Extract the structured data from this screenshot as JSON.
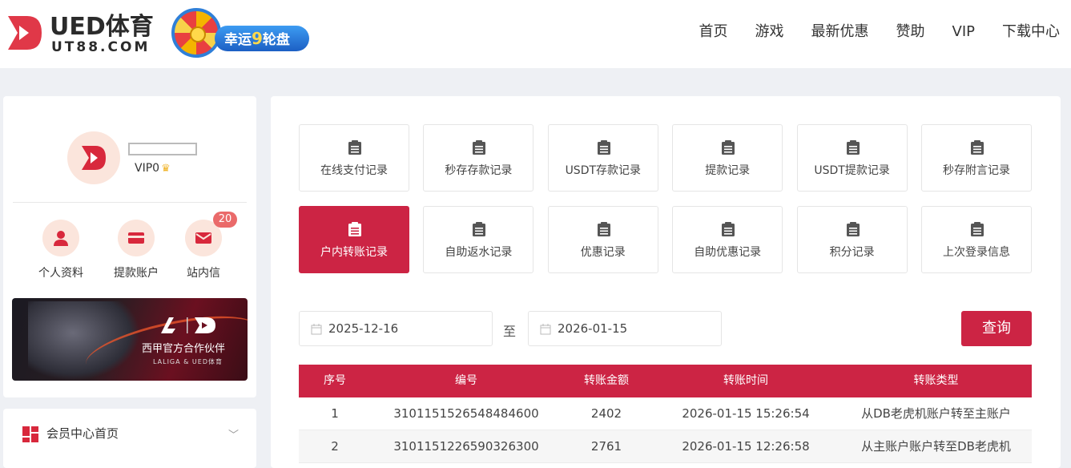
{
  "brand": {
    "name": "UED体育",
    "domain": "UT88.COM",
    "promo_label": "幸运",
    "promo_number": "9",
    "promo_suffix": "轮盘"
  },
  "nav": [
    "首页",
    "游戏",
    "最新优惠",
    "赞助",
    "VIP",
    "下载中心"
  ],
  "profile": {
    "vip_level": "VIP0",
    "quick_links": [
      {
        "label": "个人资料",
        "icon": "user-icon"
      },
      {
        "label": "提款账户",
        "icon": "card-icon"
      },
      {
        "label": "站内信",
        "icon": "mail-icon"
      }
    ],
    "message_count": "20",
    "banner_text": "西甲官方合作伙伴",
    "banner_sub": "LALIGA & UED体育"
  },
  "menu": {
    "label": "会员中心首页"
  },
  "tiles": [
    {
      "label": "在线支付记录",
      "active": false
    },
    {
      "label": "秒存存款记录",
      "active": false
    },
    {
      "label": "USDT存款记录",
      "active": false
    },
    {
      "label": "提款记录",
      "active": false
    },
    {
      "label": "USDT提款记录",
      "active": false
    },
    {
      "label": "秒存附言记录",
      "active": false
    },
    {
      "label": "户内转账记录",
      "active": true
    },
    {
      "label": "自助返水记录",
      "active": false
    },
    {
      "label": "优惠记录",
      "active": false
    },
    {
      "label": "自助优惠记录",
      "active": false
    },
    {
      "label": "积分记录",
      "active": false
    },
    {
      "label": "上次登录信息",
      "active": false
    }
  ],
  "filter": {
    "start_date": "2025-12-16",
    "to_label": "至",
    "end_date": "2026-01-15",
    "query_label": "查询"
  },
  "table": {
    "headers": [
      "序号",
      "编号",
      "转账金额",
      "转账时间",
      "转账类型"
    ],
    "rows": [
      [
        "1",
        "3101151526548484600",
        "2402",
        "2026-01-15 15:26:54",
        "从DB老虎机账户转至主账户"
      ],
      [
        "2",
        "3101151226590326300",
        "2761",
        "2026-01-15 12:26:58",
        "从主账户账户转至DB老虎机"
      ]
    ]
  },
  "colors": {
    "accent": "#cc2444",
    "icon_bg": "#fbe5dc"
  }
}
